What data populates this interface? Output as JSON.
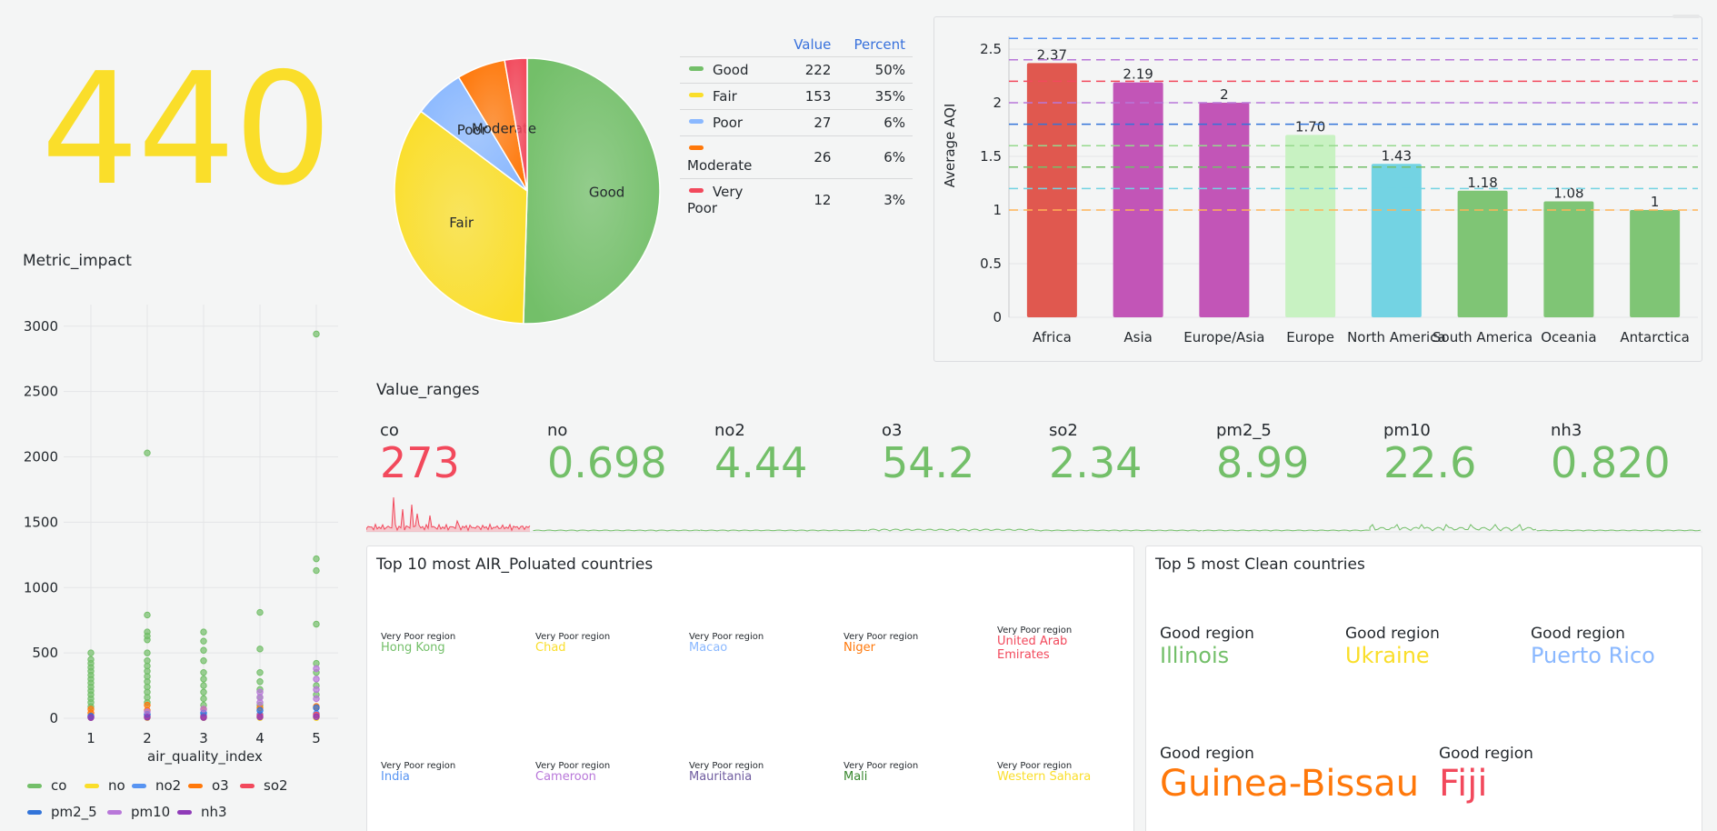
{
  "stat": {
    "value": "440",
    "color": "#fade2a"
  },
  "pie": {
    "slices": [
      {
        "label": "Good",
        "value": 222,
        "color": "#73bf69"
      },
      {
        "label": "Fair",
        "value": 153,
        "color": "#fade2a"
      },
      {
        "label": "Poor",
        "value": 27,
        "color": "#8ab8ff"
      },
      {
        "label": "Moderate",
        "value": 26,
        "color": "#ff780a"
      },
      {
        "label": "Very Poor",
        "value": 12,
        "color": "#f2495c"
      }
    ],
    "table": {
      "headers": [
        "",
        "Value",
        "Percent"
      ],
      "rows": [
        {
          "label": "Good",
          "value": "222",
          "percent": "50%",
          "color": "#73bf69"
        },
        {
          "label": "Fair",
          "value": "153",
          "percent": "35%",
          "color": "#fade2a"
        },
        {
          "label": "Poor",
          "value": "27",
          "percent": "6%",
          "color": "#8ab8ff"
        },
        {
          "label": "Moderate",
          "value": "26",
          "percent": "6%",
          "color": "#ff780a"
        },
        {
          "label": "Very Poor",
          "value": "12",
          "percent": "3%",
          "color": "#f2495c"
        }
      ]
    }
  },
  "chart_data": [
    {
      "type": "bar",
      "ylabel": "Average AQI",
      "ylim": [
        0,
        2.5
      ],
      "yticks": [
        "0",
        "0.5",
        "1",
        "1.5",
        "2",
        "2.5"
      ],
      "categories": [
        "Africa",
        "Asia",
        "Europe/Asia",
        "Europe",
        "North America",
        "South America",
        "Oceania",
        "Antarctica"
      ],
      "values": [
        2.37,
        2.19,
        2,
        1.7,
        1.43,
        1.18,
        1.08,
        1
      ],
      "labels": [
        "2.37",
        "2.19",
        "2",
        "1.70",
        "1.43",
        "1.18",
        "1.08",
        "1"
      ],
      "colors": [
        "#e0584f",
        "#c255b7",
        "#c255b7",
        "#c8f2c2",
        "#73d3e3",
        "#7fc575",
        "#7fc575",
        "#7fc575"
      ],
      "threshold_lines": [
        {
          "y": 2.6,
          "color": "#5794f2"
        },
        {
          "y": 2.4,
          "color": "#b877d9"
        },
        {
          "y": 2.2,
          "color": "#f2495c"
        },
        {
          "y": 2.0,
          "color": "#b877d9"
        },
        {
          "y": 1.8,
          "color": "#3274d9"
        },
        {
          "y": 1.6,
          "color": "#96d98d"
        },
        {
          "y": 1.4,
          "color": "#73bf69"
        },
        {
          "y": 1.2,
          "color": "#73d3e3"
        },
        {
          "y": 1.0,
          "color": "#ffb357"
        }
      ]
    },
    {
      "type": "scatter",
      "title": "Metric_impact",
      "xlabel": "air_quality_index",
      "xticks": [
        "1",
        "2",
        "3",
        "4",
        "5"
      ],
      "yticks": [
        "0",
        "500",
        "1000",
        "1500",
        "2000",
        "2500",
        "3000"
      ],
      "ylim": [
        0,
        3200
      ],
      "series": [
        {
          "name": "co",
          "color": "#73bf69",
          "points": [
            [
              1,
              90
            ],
            [
              1,
              120
            ],
            [
              1,
              150
            ],
            [
              1,
              180
            ],
            [
              1,
              210
            ],
            [
              1,
              240
            ],
            [
              1,
              270
            ],
            [
              1,
              300
            ],
            [
              1,
              330
            ],
            [
              1,
              360
            ],
            [
              1,
              390
            ],
            [
              1,
              420
            ],
            [
              1,
              450
            ],
            [
              1,
              500
            ],
            [
              2,
              120
            ],
            [
              2,
              160
            ],
            [
              2,
              200
            ],
            [
              2,
              240
            ],
            [
              2,
              280
            ],
            [
              2,
              320
            ],
            [
              2,
              360
            ],
            [
              2,
              400
            ],
            [
              2,
              440
            ],
            [
              2,
              500
            ],
            [
              2,
              600
            ],
            [
              2,
              630
            ],
            [
              2,
              660
            ],
            [
              2,
              790
            ],
            [
              2,
              2030
            ],
            [
              3,
              100
            ],
            [
              3,
              150
            ],
            [
              3,
              200
            ],
            [
              3,
              250
            ],
            [
              3,
              300
            ],
            [
              3,
              350
            ],
            [
              3,
              440
            ],
            [
              3,
              520
            ],
            [
              3,
              590
            ],
            [
              3,
              660
            ],
            [
              4,
              100
            ],
            [
              4,
              160
            ],
            [
              4,
              220
            ],
            [
              4,
              280
            ],
            [
              4,
              350
            ],
            [
              4,
              530
            ],
            [
              4,
              810
            ],
            [
              5,
              180
            ],
            [
              5,
              250
            ],
            [
              5,
              350
            ],
            [
              5,
              420
            ],
            [
              5,
              720
            ],
            [
              5,
              1130
            ],
            [
              5,
              1220
            ],
            [
              5,
              2940
            ]
          ]
        },
        {
          "name": "no",
          "color": "#fade2a",
          "points": [
            [
              1,
              5
            ],
            [
              2,
              5
            ],
            [
              3,
              5
            ],
            [
              4,
              5
            ],
            [
              5,
              5
            ]
          ]
        },
        {
          "name": "no2",
          "color": "#5794f2",
          "points": [
            [
              1,
              20
            ],
            [
              2,
              25
            ],
            [
              3,
              22
            ],
            [
              4,
              30
            ],
            [
              5,
              35
            ]
          ]
        },
        {
          "name": "o3",
          "color": "#ff780a",
          "points": [
            [
              1,
              40
            ],
            [
              1,
              70
            ],
            [
              2,
              60
            ],
            [
              2,
              100
            ],
            [
              3,
              70
            ],
            [
              4,
              80
            ],
            [
              5,
              90
            ]
          ]
        },
        {
          "name": "so2",
          "color": "#f2495c",
          "points": [
            [
              1,
              10
            ],
            [
              2,
              15
            ],
            [
              3,
              12
            ],
            [
              4,
              20
            ],
            [
              5,
              25
            ]
          ]
        },
        {
          "name": "pm2_5",
          "color": "#3274d9",
          "points": [
            [
              1,
              15
            ],
            [
              2,
              30
            ],
            [
              3,
              40
            ],
            [
              4,
              60
            ],
            [
              5,
              80
            ]
          ]
        },
        {
          "name": "pm10",
          "color": "#b877d9",
          "points": [
            [
              2,
              50
            ],
            [
              3,
              70
            ],
            [
              4,
              120
            ],
            [
              4,
              160
            ],
            [
              4,
              200
            ],
            [
              5,
              150
            ],
            [
              5,
              220
            ],
            [
              5,
              300
            ],
            [
              5,
              380
            ]
          ]
        },
        {
          "name": "nh3",
          "color": "#8f3bb8",
          "points": [
            [
              1,
              5
            ],
            [
              2,
              8
            ],
            [
              3,
              6
            ],
            [
              4,
              10
            ],
            [
              5,
              12
            ]
          ]
        }
      ]
    }
  ],
  "metric_panel": {
    "title": "Metric_impact",
    "xlabel": "air_quality_index",
    "legend": [
      {
        "name": "co",
        "color": "#73bf69"
      },
      {
        "name": "no",
        "color": "#fade2a"
      },
      {
        "name": "no2",
        "color": "#5794f2"
      },
      {
        "name": "o3",
        "color": "#ff780a"
      },
      {
        "name": "so2",
        "color": "#f2495c"
      },
      {
        "name": "pm2_5",
        "color": "#3274d9"
      },
      {
        "name": "pm10",
        "color": "#b877d9"
      },
      {
        "name": "nh3",
        "color": "#8f3bb8"
      }
    ]
  },
  "value_ranges": {
    "title": "Value_ranges",
    "items": [
      {
        "label": "co",
        "value": "273",
        "color": "#f2495c"
      },
      {
        "label": "no",
        "value": "0.698",
        "color": "#73bf69"
      },
      {
        "label": "no2",
        "value": "4.44",
        "color": "#73bf69"
      },
      {
        "label": "o3",
        "value": "54.2",
        "color": "#73bf69"
      },
      {
        "label": "so2",
        "value": "2.34",
        "color": "#73bf69"
      },
      {
        "label": "pm2_5",
        "value": "8.99",
        "color": "#73bf69"
      },
      {
        "label": "pm10",
        "value": "22.6",
        "color": "#73bf69"
      },
      {
        "label": "nh3",
        "value": "0.820",
        "color": "#73bf69"
      }
    ]
  },
  "polluted": {
    "title": "Top 10 most AIR_Poluated countries",
    "region_label": "Very Poor region",
    "items": [
      {
        "name": "Hong Kong",
        "color": "#73bf69"
      },
      {
        "name": "Chad",
        "color": "#fade2a"
      },
      {
        "name": "Macao",
        "color": "#8ab8ff"
      },
      {
        "name": "Niger",
        "color": "#ff780a"
      },
      {
        "name": "United Arab Emirates",
        "color": "#f2495c"
      },
      {
        "name": "India",
        "color": "#5794f2"
      },
      {
        "name": "Cameroon",
        "color": "#b877d9"
      },
      {
        "name": "Mauritania",
        "color": "#705da0"
      },
      {
        "name": "Mali",
        "color": "#37872d"
      },
      {
        "name": "Western Sahara",
        "color": "#fade2a"
      }
    ]
  },
  "clean": {
    "title": "Top 5 most Clean countries",
    "region_label": "Good region",
    "items": [
      {
        "name": "Illinois",
        "color": "#73bf69"
      },
      {
        "name": "Ukraine",
        "color": "#fade2a"
      },
      {
        "name": "Puerto Rico",
        "color": "#8ab8ff"
      },
      {
        "name": "Guinea-Bissau",
        "color": "#ff780a"
      },
      {
        "name": "Fiji",
        "color": "#f2495c"
      }
    ]
  }
}
